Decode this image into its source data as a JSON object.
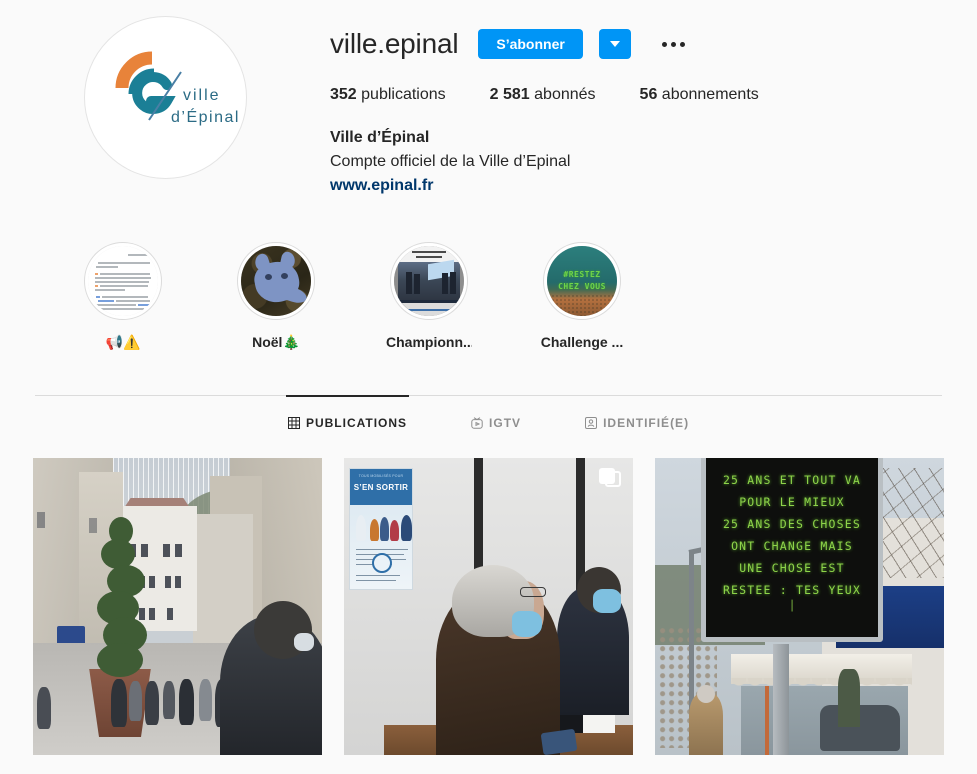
{
  "profile": {
    "username": "ville.epinal",
    "avatar_alt": "ville-epinal-logo",
    "logo_text_line1": "ville",
    "logo_text_line2": "d’Épinal",
    "follow_button": "S’abonner",
    "dropdown_icon": "chevron-down-icon",
    "options_icon": "more-options-icon",
    "stats": [
      {
        "value": "352",
        "label": "publications"
      },
      {
        "value": "2 581",
        "label": "abonnés"
      },
      {
        "value": "56",
        "label": "abonnements"
      }
    ],
    "full_name": "Ville d’Épinal",
    "bio": "Compte officiel de la Ville d’Epinal",
    "website": "www.epinal.fr"
  },
  "highlights": [
    {
      "label": "📢⚠️",
      "thumb": "document-screenshot"
    },
    {
      "label": "Noël🎄",
      "thumb": "cat-sculpture-photo"
    },
    {
      "label": "Championn...",
      "thumb": "championnat-event-photo"
    },
    {
      "label": "Challenge ...",
      "thumb": "restez-chez-vous-led"
    }
  ],
  "tabs": [
    {
      "label": "PUBLICATIONS",
      "icon": "grid-icon",
      "active": true
    },
    {
      "label": "IGTV",
      "icon": "igtv-icon",
      "active": false
    },
    {
      "label": "IDENTIFIÉ(E)",
      "icon": "tagged-person-icon",
      "active": false
    }
  ],
  "posts": [
    {
      "alt": "pedestrian-street-epinal",
      "multi": false
    },
    {
      "alt": "vaccination-center-sen-sortir",
      "multi": true
    },
    {
      "alt": "led-message-board",
      "multi": false
    }
  ],
  "post2_poster": {
    "subtitle": "TOUS MOBILISÉS POUR",
    "title": "S’EN SORTIR"
  },
  "post3_board": {
    "lines": [
      "25 ANS ET TOUT VA",
      "POUR LE MIEUX",
      "25 ANS DES CHOSES",
      "ONT CHANGE MAIS",
      "UNE CHOSE EST",
      "RESTEE : TES YEUX"
    ],
    "cursor": "│"
  },
  "highlight4_text": {
    "line1": "#RESTEZ",
    "line2": "CHEZ VOUS"
  },
  "colors": {
    "accent_blue": "#0095f6",
    "link_blue": "#00376b",
    "text_primary": "#262626",
    "text_secondary": "#8e8e8e",
    "background": "#fafafa",
    "border": "#dbdbdb",
    "logo_orange": "#e8833a",
    "logo_teal": "#1b7f96",
    "led_green": "#8ed44a"
  }
}
